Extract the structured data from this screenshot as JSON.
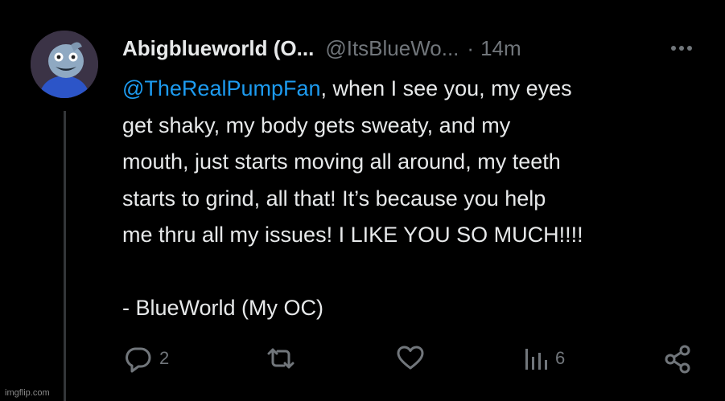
{
  "tweet": {
    "display_name": "Abigblueworld (O...",
    "handle": "@ItsBlueWo...",
    "separator": "·",
    "time_ago": "14m",
    "mention": "@TheRealPumpFan",
    "lines": [
      ", when I see you, my eyes",
      "get shaky, my body gets sweaty, and my",
      "mouth, just starts moving all around, my teeth",
      "starts to grind, all that! It’s because you help",
      "me thru all my issues! I LIKE YOU SO MUCH!!!!",
      "",
      "- BlueWorld (My OC)"
    ]
  },
  "actions": {
    "reply_count": "2",
    "retweet_count": "",
    "like_count": "",
    "views_count": "6"
  },
  "watermark": "imgflip.com",
  "colors": {
    "background": "#000000",
    "text": "#e7e9ea",
    "secondary": "#71767b",
    "accent": "#1d9bf0",
    "avatar_body": "#2c55c8"
  },
  "icons": {
    "more": "more-horizontal-icon",
    "reply": "reply-icon",
    "retweet": "retweet-icon",
    "like": "heart-icon",
    "views": "views-icon",
    "share": "share-icon"
  }
}
